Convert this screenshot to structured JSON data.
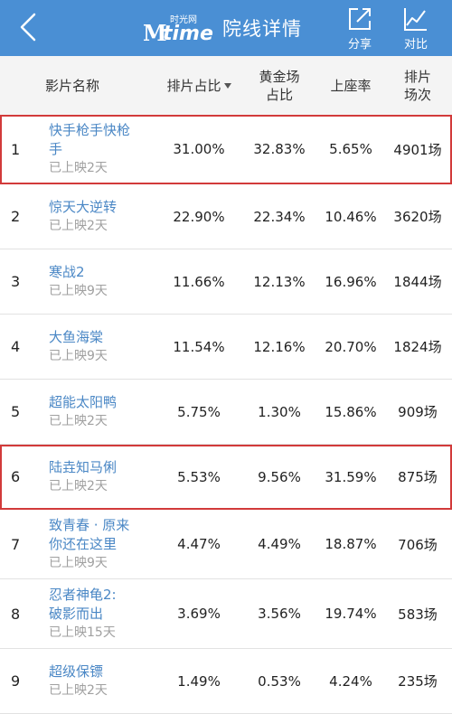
{
  "topbar": {
    "logo_m": "M",
    "logo_time": "time",
    "logo_sub": "时光网",
    "title": "院线详情",
    "share_label": "分享",
    "compare_label": "对比"
  },
  "columns": {
    "name": "影片名称",
    "schedule_ratio": "排片占比",
    "prime_ratio": "黄金场\n占比",
    "occupancy": "上座率",
    "shows": "排片\n场次"
  },
  "rows": [
    {
      "rank": "1",
      "title": "快手枪手快枪\n手",
      "days": "已上映2天",
      "schedule_ratio": "31.00%",
      "prime_ratio": "32.83%",
      "occupancy": "5.65%",
      "shows": "4901场",
      "highlighted": true
    },
    {
      "rank": "2",
      "title": "惊天大逆转",
      "days": "已上映2天",
      "schedule_ratio": "22.90%",
      "prime_ratio": "22.34%",
      "occupancy": "10.46%",
      "shows": "3620场",
      "highlighted": false
    },
    {
      "rank": "3",
      "title": "寒战2",
      "days": "已上映9天",
      "schedule_ratio": "11.66%",
      "prime_ratio": "12.13%",
      "occupancy": "16.96%",
      "shows": "1844场",
      "highlighted": false
    },
    {
      "rank": "4",
      "title": "大鱼海棠",
      "days": "已上映9天",
      "schedule_ratio": "11.54%",
      "prime_ratio": "12.16%",
      "occupancy": "20.70%",
      "shows": "1824场",
      "highlighted": false
    },
    {
      "rank": "5",
      "title": "超能太阳鸭",
      "days": "已上映2天",
      "schedule_ratio": "5.75%",
      "prime_ratio": "1.30%",
      "occupancy": "15.86%",
      "shows": "909场",
      "highlighted": false
    },
    {
      "rank": "6",
      "title": "陆垚知马俐",
      "days": "已上映2天",
      "schedule_ratio": "5.53%",
      "prime_ratio": "9.56%",
      "occupancy": "31.59%",
      "shows": "875场",
      "highlighted": true
    },
    {
      "rank": "7",
      "title": "致青春 · 原来\n你还在这里",
      "days": "已上映9天",
      "schedule_ratio": "4.47%",
      "prime_ratio": "4.49%",
      "occupancy": "18.87%",
      "shows": "706场",
      "highlighted": false
    },
    {
      "rank": "8",
      "title": "忍者神龟2:\n破影而出",
      "days": "已上映15天",
      "schedule_ratio": "3.69%",
      "prime_ratio": "3.56%",
      "occupancy": "19.74%",
      "shows": "583场",
      "highlighted": false
    },
    {
      "rank": "9",
      "title": "超级保镖",
      "days": "已上映2天",
      "schedule_ratio": "1.49%",
      "prime_ratio": "0.53%",
      "occupancy": "4.24%",
      "shows": "235场",
      "highlighted": false
    }
  ]
}
